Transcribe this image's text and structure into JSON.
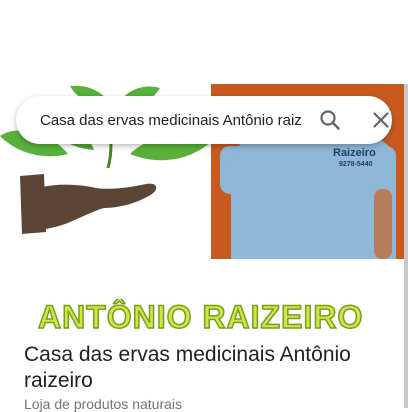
{
  "search": {
    "query": "Casa das ervas medicinais Antônio raizeiro",
    "search_icon": "search-icon",
    "close_icon": "close-icon"
  },
  "photo": {
    "banner_text": "ANTÔNIO RAIZEIRO",
    "shirt_text": "Raizeiro",
    "shirt_phone": "9278-5440"
  },
  "place": {
    "name": "Casa das ervas medicinais Antônio raizeiro",
    "category": "Loja de produtos naturais"
  },
  "colors": {
    "leaf_green": "#58b13a",
    "banner_yellow": "#cbe84a",
    "hand_brown": "#5a4536",
    "shirt_blue": "#8fb7d7",
    "background_orange": "#c85a20"
  }
}
